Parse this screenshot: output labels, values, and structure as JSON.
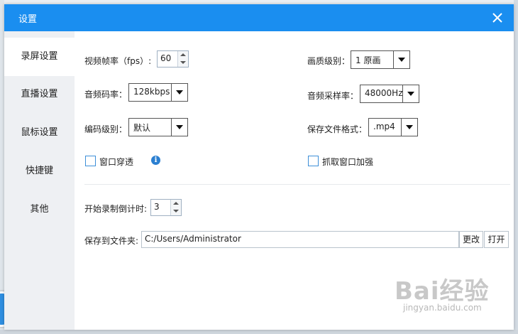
{
  "window": {
    "title": "设置",
    "close_icon": "close-icon"
  },
  "sidebar": {
    "items": [
      {
        "label": "录屏设置",
        "active": true
      },
      {
        "label": "直播设置",
        "active": false
      },
      {
        "label": "鼠标设置",
        "active": false
      },
      {
        "label": "快捷键",
        "active": false
      },
      {
        "label": "其他",
        "active": false
      }
    ]
  },
  "settings": {
    "fps_label": "视频帧率（fps）:",
    "fps_value": "60",
    "quality_label": "画质级别：",
    "quality_value": "1 原画",
    "audio_bitrate_label": "音频码率：",
    "audio_bitrate_value": "128kbps",
    "sample_rate_label": "音频采样率：",
    "sample_rate_value": "48000Hz",
    "encode_level_label": "编码级别：",
    "encode_level_value": "默认",
    "file_format_label": "保存文件格式：",
    "file_format_value": ".mp4",
    "window_through_label": "窗口穿透",
    "window_through_checked": false,
    "info_icon": "info-icon",
    "capture_enhance_label": "抓取窗口加强",
    "capture_enhance_checked": false,
    "countdown_label": "开始录制倒计时:",
    "countdown_value": "3",
    "save_folder_label": "保存到文件夹:",
    "save_folder_value": "C:/Users/Administrator",
    "change_label": "更改",
    "open_label": "打开"
  },
  "watermark": {
    "brand": "Bai经验",
    "url": "jingyan.baidu.com"
  },
  "colors": {
    "accent": "#1a8ef0",
    "sidebar": "#eef0f3",
    "checkbox": "#3e8fd8"
  }
}
